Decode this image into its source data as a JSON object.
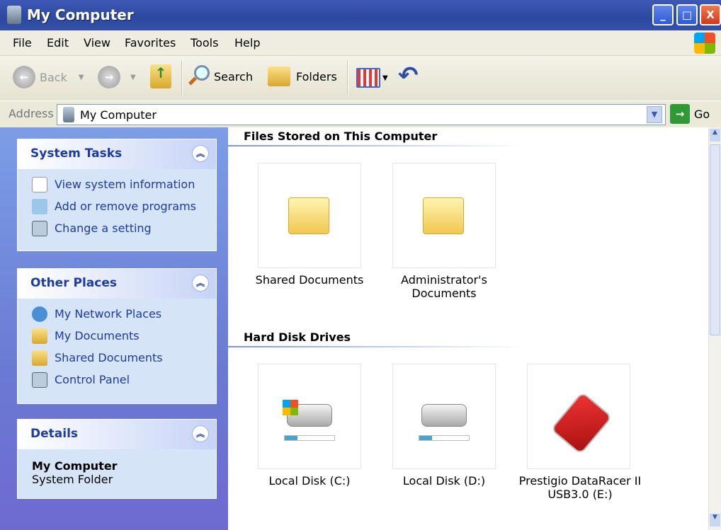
{
  "window": {
    "title": "My Computer",
    "minimize": "_",
    "maximize": "□",
    "close": "X"
  },
  "menu": [
    "File",
    "Edit",
    "View",
    "Favorites",
    "Tools",
    "Help"
  ],
  "toolbar": {
    "back": "Back",
    "search": "Search",
    "folders": "Folders"
  },
  "address": {
    "label": "Address",
    "value": "My Computer",
    "go": "Go"
  },
  "sidebar": {
    "system_tasks": {
      "title": "System Tasks",
      "items": [
        "View system information",
        "Add or remove programs",
        "Change a setting"
      ]
    },
    "other_places": {
      "title": "Other Places",
      "items": [
        "My Network Places",
        "My Documents",
        "Shared Documents",
        "Control Panel"
      ]
    },
    "details": {
      "title": "Details",
      "name": "My Computer",
      "type": "System Folder"
    }
  },
  "content": {
    "files_header": "Files Stored on This Computer",
    "files": [
      "Shared Documents",
      "Administrator's Documents"
    ],
    "drives_header": "Hard Disk Drives",
    "drives": [
      {
        "label": "Local Disk (C:)",
        "used_fraction": 0.25
      },
      {
        "label": "Local Disk (D:)",
        "used_fraction": 0.25
      },
      {
        "label": "Prestigio DataRacer II USB3.0 (E:)"
      }
    ]
  },
  "colors": {
    "titlebar": "#2d48a0",
    "sidebar": "#7b9ee6",
    "panel_text": "#1d3c9d",
    "close": "#e0552c"
  }
}
